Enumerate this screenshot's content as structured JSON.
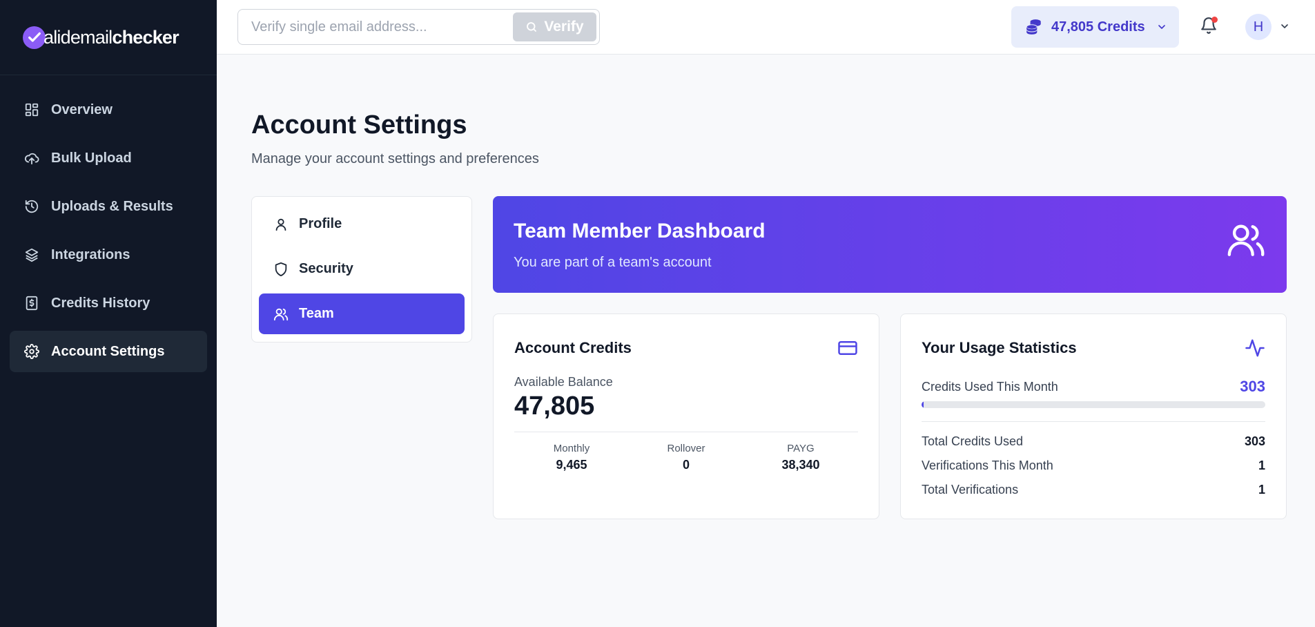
{
  "brand": {
    "logo_prefix": "alidemail",
    "logo_bold": "checker",
    "accent": "#4f46e5",
    "sidebar_bg": "#111827"
  },
  "sidebar": {
    "items": [
      {
        "label": "Overview",
        "icon": "dashboard-grid-icon",
        "active": false
      },
      {
        "label": "Bulk Upload",
        "icon": "cloud-upload-icon",
        "active": false
      },
      {
        "label": "Uploads & Results",
        "icon": "history-icon",
        "active": false
      },
      {
        "label": "Integrations",
        "icon": "layers-icon",
        "active": false
      },
      {
        "label": "Credits History",
        "icon": "receipt-icon",
        "active": false
      },
      {
        "label": "Account Settings",
        "icon": "gear-icon",
        "active": true
      }
    ]
  },
  "topbar": {
    "search_placeholder": "Verify single email address...",
    "search_value": "",
    "verify_label": "Verify",
    "credits_label": "47,805 Credits",
    "avatar_initial": "H",
    "has_notification": true
  },
  "page": {
    "title": "Account Settings",
    "subtitle": "Manage your account settings and preferences"
  },
  "settings_nav": {
    "items": [
      {
        "label": "Profile",
        "icon": "user-icon",
        "active": false
      },
      {
        "label": "Security",
        "icon": "shield-icon",
        "active": false
      },
      {
        "label": "Team",
        "icon": "users-icon",
        "active": true
      }
    ]
  },
  "banner": {
    "title": "Team Member Dashboard",
    "subtitle": "You are part of a team's account"
  },
  "credits_card": {
    "title": "Account Credits",
    "available_label": "Available Balance",
    "available_value": "47,805",
    "breakdown": [
      {
        "label": "Monthly",
        "value": "9,465"
      },
      {
        "label": "Rollover",
        "value": "0"
      },
      {
        "label": "PAYG",
        "value": "38,340"
      }
    ]
  },
  "usage_card": {
    "title": "Your Usage Statistics",
    "used_label": "Credits Used This Month",
    "used_value": "303",
    "used_progress_percent": 0.6,
    "stats": [
      {
        "label": "Total Credits Used",
        "value": "303"
      },
      {
        "label": "Verifications This Month",
        "value": "1"
      },
      {
        "label": "Total Verifications",
        "value": "1"
      }
    ]
  }
}
